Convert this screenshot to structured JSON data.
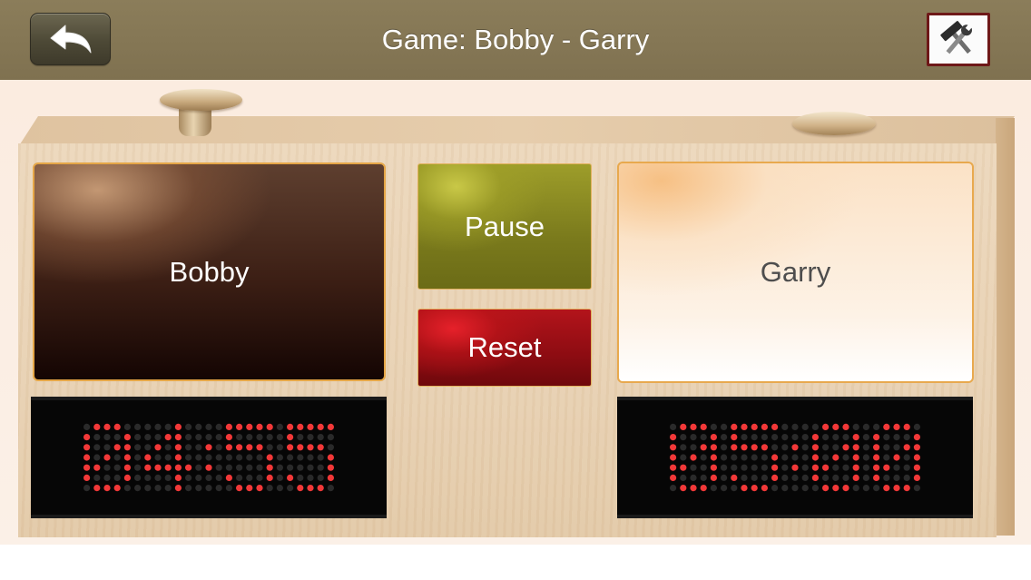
{
  "header": {
    "title": "Game: Bobby - Garry"
  },
  "players": {
    "left": {
      "name": "Bobby",
      "time": "04:55"
    },
    "right": {
      "name": "Garry",
      "time": "05:00"
    }
  },
  "controls": {
    "pause_label": "Pause",
    "reset_label": "Reset"
  },
  "colors": {
    "header_bg": "#837552",
    "led_on": "#ff3b3b",
    "led_off": "#2a2a2a",
    "pause": "#8c8c22",
    "reset": "#a3111a",
    "panel_border": "#e5a647"
  },
  "icons": {
    "back": "back-arrow-icon",
    "settings": "tools-icon"
  }
}
